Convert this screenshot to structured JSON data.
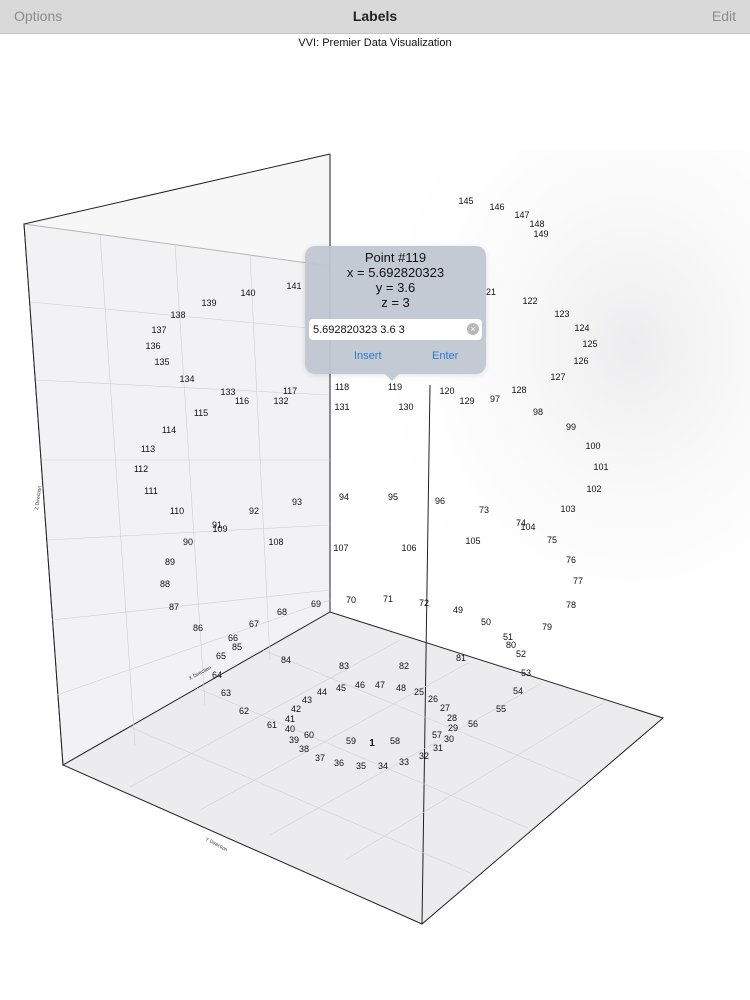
{
  "navbar": {
    "left_button": "Options",
    "title": "Labels",
    "right_button": "Edit"
  },
  "subtitle": "VVI: Premier Data Visualization",
  "popup": {
    "title": "Point #119",
    "x_line": "x = 5.692820323",
    "y_line": "y = 3.6",
    "z_line": "z = 3",
    "input_value": "5.692820323 3.6 3",
    "clear_icon": "clear-circle-icon",
    "insert_label": "Insert",
    "enter_label": "Enter"
  },
  "axes": {
    "x_label": "X Direction",
    "y_label": "Y Direction",
    "z_label": "Z Direction"
  },
  "chart_data": {
    "type": "scatter",
    "title": "VVI: Premier Data Visualization",
    "series": [
      {
        "values": [
          {
            "label": "145"
          },
          {
            "label": "146"
          },
          {
            "label": "147"
          },
          {
            "label": "148"
          },
          {
            "label": "149"
          },
          {
            "label": "141"
          },
          {
            "label": "140"
          },
          {
            "label": "139"
          },
          {
            "label": "138"
          },
          {
            "label": "137"
          },
          {
            "label": "136"
          },
          {
            "label": "135"
          },
          {
            "label": "134"
          },
          {
            "label": "133"
          },
          {
            "label": "116"
          },
          {
            "label": "132"
          },
          {
            "label": "117"
          },
          {
            "label": "118"
          },
          {
            "label": "119"
          },
          {
            "label": "120"
          },
          {
            "label": "129"
          },
          {
            "label": "97"
          },
          {
            "label": "128"
          },
          {
            "label": "98"
          },
          {
            "label": "21"
          },
          {
            "label": "122"
          },
          {
            "label": "123"
          },
          {
            "label": "124"
          },
          {
            "label": "125"
          },
          {
            "label": "126"
          },
          {
            "label": "127"
          },
          {
            "label": "131"
          },
          {
            "label": "130"
          },
          {
            "label": "115"
          },
          {
            "label": "114"
          },
          {
            "label": "113"
          },
          {
            "label": "112"
          },
          {
            "label": "111"
          },
          {
            "label": "110"
          },
          {
            "label": "91"
          },
          {
            "label": "109"
          },
          {
            "label": "92"
          },
          {
            "label": "93"
          },
          {
            "label": "94"
          },
          {
            "label": "95"
          },
          {
            "label": "96"
          },
          {
            "label": "73"
          },
          {
            "label": "74"
          },
          {
            "label": "104"
          },
          {
            "label": "103"
          },
          {
            "label": "102"
          },
          {
            "label": "101"
          },
          {
            "label": "100"
          },
          {
            "label": "99"
          },
          {
            "label": "90"
          },
          {
            "label": "108"
          },
          {
            "label": "107"
          },
          {
            "label": "106"
          },
          {
            "label": "105"
          },
          {
            "label": "75"
          },
          {
            "label": "76"
          },
          {
            "label": "77"
          },
          {
            "label": "78"
          },
          {
            "label": "79"
          },
          {
            "label": "89"
          },
          {
            "label": "88"
          },
          {
            "label": "87"
          },
          {
            "label": "86"
          },
          {
            "label": "70"
          },
          {
            "label": "71"
          },
          {
            "label": "72"
          },
          {
            "label": "49"
          },
          {
            "label": "50"
          },
          {
            "label": "51"
          },
          {
            "label": "80"
          },
          {
            "label": "52"
          },
          {
            "label": "81"
          },
          {
            "label": "53"
          },
          {
            "label": "54"
          },
          {
            "label": "55"
          },
          {
            "label": "56"
          },
          {
            "label": "69"
          },
          {
            "label": "68"
          },
          {
            "label": "67"
          },
          {
            "label": "66"
          },
          {
            "label": "85"
          },
          {
            "label": "65"
          },
          {
            "label": "84"
          },
          {
            "label": "83"
          },
          {
            "label": "82"
          },
          {
            "label": "64"
          },
          {
            "label": "63"
          },
          {
            "label": "62"
          },
          {
            "label": "61"
          },
          {
            "label": "44"
          },
          {
            "label": "45"
          },
          {
            "label": "46"
          },
          {
            "label": "47"
          },
          {
            "label": "48"
          },
          {
            "label": "25"
          },
          {
            "label": "26"
          },
          {
            "label": "27"
          },
          {
            "label": "28"
          },
          {
            "label": "29"
          },
          {
            "label": "30"
          },
          {
            "label": "31"
          },
          {
            "label": "57"
          },
          {
            "label": "43"
          },
          {
            "label": "42"
          },
          {
            "label": "41"
          },
          {
            "label": "40"
          },
          {
            "label": "39"
          },
          {
            "label": "60"
          },
          {
            "label": "38"
          },
          {
            "label": "37"
          },
          {
            "label": "36"
          },
          {
            "label": "35"
          },
          {
            "label": "34"
          },
          {
            "label": "33"
          },
          {
            "label": "32"
          },
          {
            "label": "59"
          },
          {
            "label": "58"
          },
          {
            "label": "1"
          }
        ]
      }
    ]
  }
}
